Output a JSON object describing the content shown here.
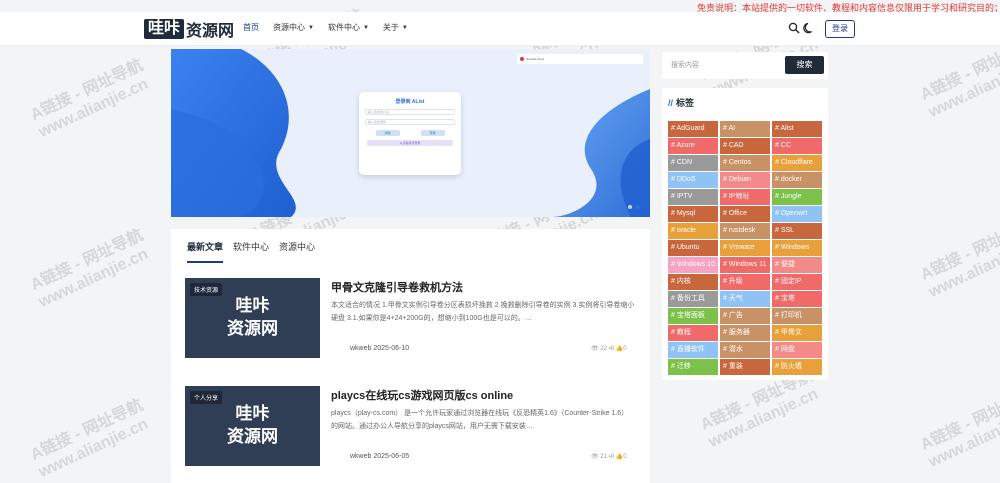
{
  "notice": "免责说明：本站提供的一切软件、教程和内容信息仅限用于学习和研究目的；不得",
  "brand": {
    "logo_box": "哇咔",
    "logo_rest": "资源网"
  },
  "nav": [
    {
      "label": "首页",
      "active": true,
      "chevron": false
    },
    {
      "label": "资源中心",
      "active": false,
      "chevron": true
    },
    {
      "label": "软件中心",
      "active": false,
      "chevron": true
    },
    {
      "label": "关于",
      "active": false,
      "chevron": true
    }
  ],
  "header_icons": [
    "search-icon",
    "moon-icon"
  ],
  "login_label": "登录",
  "banner": {
    "card_title": "登录到 AList",
    "field1": "输入您的用户名",
    "field2": "输入您的密码",
    "remember": "记住我",
    "btn_clear": "清除",
    "btn_login": "登录",
    "btn_other": "以访客身份登录",
    "toast": "Network Error",
    "slide_count": 2,
    "active_slide": 2
  },
  "tabs": [
    {
      "label": "最新文章",
      "active": true
    },
    {
      "label": "软件中心",
      "active": false
    },
    {
      "label": "资源中心",
      "active": false
    }
  ],
  "posts": [
    {
      "category": "技术资源",
      "thumb_line1": "哇咔",
      "thumb_line2": "资源网",
      "title": "甲骨文克隆引导卷救机方法",
      "excerpt": "本文适合的情况 1.甲骨文实例引导卷分区表损坏挽救 2.挽救删除引导卷的实例 3.实例将引导卷缩小硬盘 3.1.如果你是4+24+200G的，想缩小到100G也是可以的。…",
      "author": "wkweb",
      "date": "2025-06-10",
      "views": "22",
      "comments": "0",
      "likes": "0"
    },
    {
      "category": "个人分享",
      "thumb_line1": "哇咔",
      "thumb_line2": "资源网",
      "title": "playcs在线玩cs游戏网页版cs online",
      "excerpt": "playcs（play-cs.com） 是一个允许玩家通过浏览器在线玩《反恐精英1.6》（Counter-Strike 1.6）的网站。通过办公人导航分享的playcs网站，用户无需下载安装…",
      "author": "wkweb",
      "date": "2025-06-05",
      "views": "21",
      "comments": "0",
      "likes": "0"
    }
  ],
  "search": {
    "placeholder": "搜索内容",
    "button": "搜索"
  },
  "tags_title": "标签",
  "tags": [
    {
      "label": "# AdGuard",
      "color": "#c8663d"
    },
    {
      "label": "# AI",
      "color": "#c89266"
    },
    {
      "label": "# Alist",
      "color": "#c8663d"
    },
    {
      "label": "# Azure",
      "color": "#f06a6a"
    },
    {
      "label": "# CAD",
      "color": "#c8663d"
    },
    {
      "label": "# CC",
      "color": "#f06a6a"
    },
    {
      "label": "# CDN",
      "color": "#9a9a9a"
    },
    {
      "label": "# Centos",
      "color": "#c89266"
    },
    {
      "label": "# Cloudflare",
      "color": "#e8a13a"
    },
    {
      "label": "# DDoS",
      "color": "#8fc3f5"
    },
    {
      "label": "# Debian",
      "color": "#f28a8a"
    },
    {
      "label": "# docker",
      "color": "#c89266"
    },
    {
      "label": "# IPTV",
      "color": "#9a9a9a"
    },
    {
      "label": "# IP地址",
      "color": "#f06a6a"
    },
    {
      "label": "# Jungle",
      "color": "#7cc24a"
    },
    {
      "label": "# Mysql",
      "color": "#c8663d"
    },
    {
      "label": "# Office",
      "color": "#c8663d"
    },
    {
      "label": "# Openwrt",
      "color": "#8fc3f5"
    },
    {
      "label": "# oracle",
      "color": "#e8a13a"
    },
    {
      "label": "# rustdesk",
      "color": "#c89266"
    },
    {
      "label": "# SSL",
      "color": "#c8663d"
    },
    {
      "label": "# Ubuntu",
      "color": "#c8663d"
    },
    {
      "label": "# Vmware",
      "color": "#e8a13a"
    },
    {
      "label": "# Windows",
      "color": "#e8a13a"
    },
    {
      "label": "# Windows 10",
      "color": "#f5a3c0"
    },
    {
      "label": "# Windows 11",
      "color": "#f06a6a"
    },
    {
      "label": "# 便捷",
      "color": "#f28a8a"
    },
    {
      "label": "# 内核",
      "color": "#c8663d"
    },
    {
      "label": "# 升级",
      "color": "#f06a6a"
    },
    {
      "label": "# 固定IP",
      "color": "#f06a6a"
    },
    {
      "label": "# 备份工具",
      "color": "#9a9a9a"
    },
    {
      "label": "# 天气",
      "color": "#8fc3f5"
    },
    {
      "label": "# 宝塔",
      "color": "#f06a6a"
    },
    {
      "label": "# 宝塔面板",
      "color": "#7cc24a"
    },
    {
      "label": "# 广告",
      "color": "#c89266"
    },
    {
      "label": "# 打印机",
      "color": "#c89266"
    },
    {
      "label": "# 教程",
      "color": "#f06a6a"
    },
    {
      "label": "# 服务器",
      "color": "#c89266"
    },
    {
      "label": "# 甲骨文",
      "color": "#e8a13a"
    },
    {
      "label": "# 直播软件",
      "color": "#8fc3f5"
    },
    {
      "label": "# 潜水",
      "color": "#c89266"
    },
    {
      "label": "# 网盘",
      "color": "#f28a8a"
    },
    {
      "label": "# 迁移",
      "color": "#7cc24a"
    },
    {
      "label": "# 重装",
      "color": "#c8663d"
    },
    {
      "label": "# 防火墙",
      "color": "#e8a13a"
    }
  ],
  "watermark": {
    "line1": "A链接 - 网址导航",
    "line2": "www.alianjie.cn"
  }
}
